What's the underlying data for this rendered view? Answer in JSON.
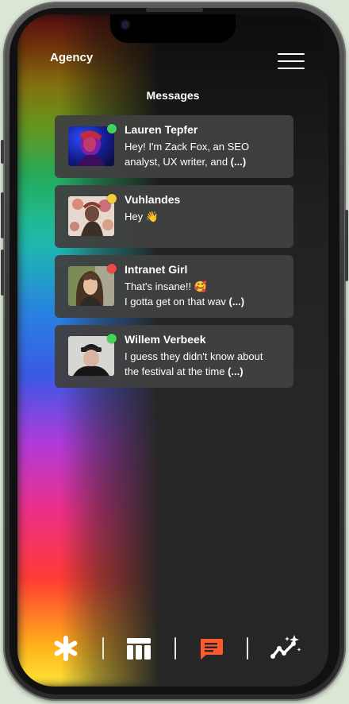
{
  "app": {
    "brand": "Agency",
    "screen_title": "Messages"
  },
  "messages": [
    {
      "name": "Lauren Tepfer",
      "line1": "Hey! I'm Zack Fox, an SEO",
      "line2": "analyst, UX writer, and ",
      "more": "(...)",
      "status": "online",
      "status_color": "#3fd35a"
    },
    {
      "name": "Vuhlandes",
      "line1": "Hey 👋",
      "line2": "",
      "more": "",
      "status": "away",
      "status_color": "#f2cc3a"
    },
    {
      "name": "Intranet Girl",
      "line1": "That's insane!! 🥰",
      "line2": "I gotta get on that wav ",
      "more": "(...)",
      "status": "busy",
      "status_color": "#ef4848"
    },
    {
      "name": "Willem Verbeek",
      "line1": "I guess they didn't know about",
      "line2": "the festival at the time ",
      "more": "(...)",
      "status": "online",
      "status_color": "#3fd35a"
    }
  ],
  "tabbar": {
    "tabs": [
      {
        "icon": "asterisk-icon",
        "active": false
      },
      {
        "icon": "table-icon",
        "active": false
      },
      {
        "icon": "chat-icon",
        "active": true
      },
      {
        "icon": "sparkle-chart-icon",
        "active": false
      }
    ],
    "active_color": "#ff5a2e",
    "inactive_color": "#ffffff"
  }
}
